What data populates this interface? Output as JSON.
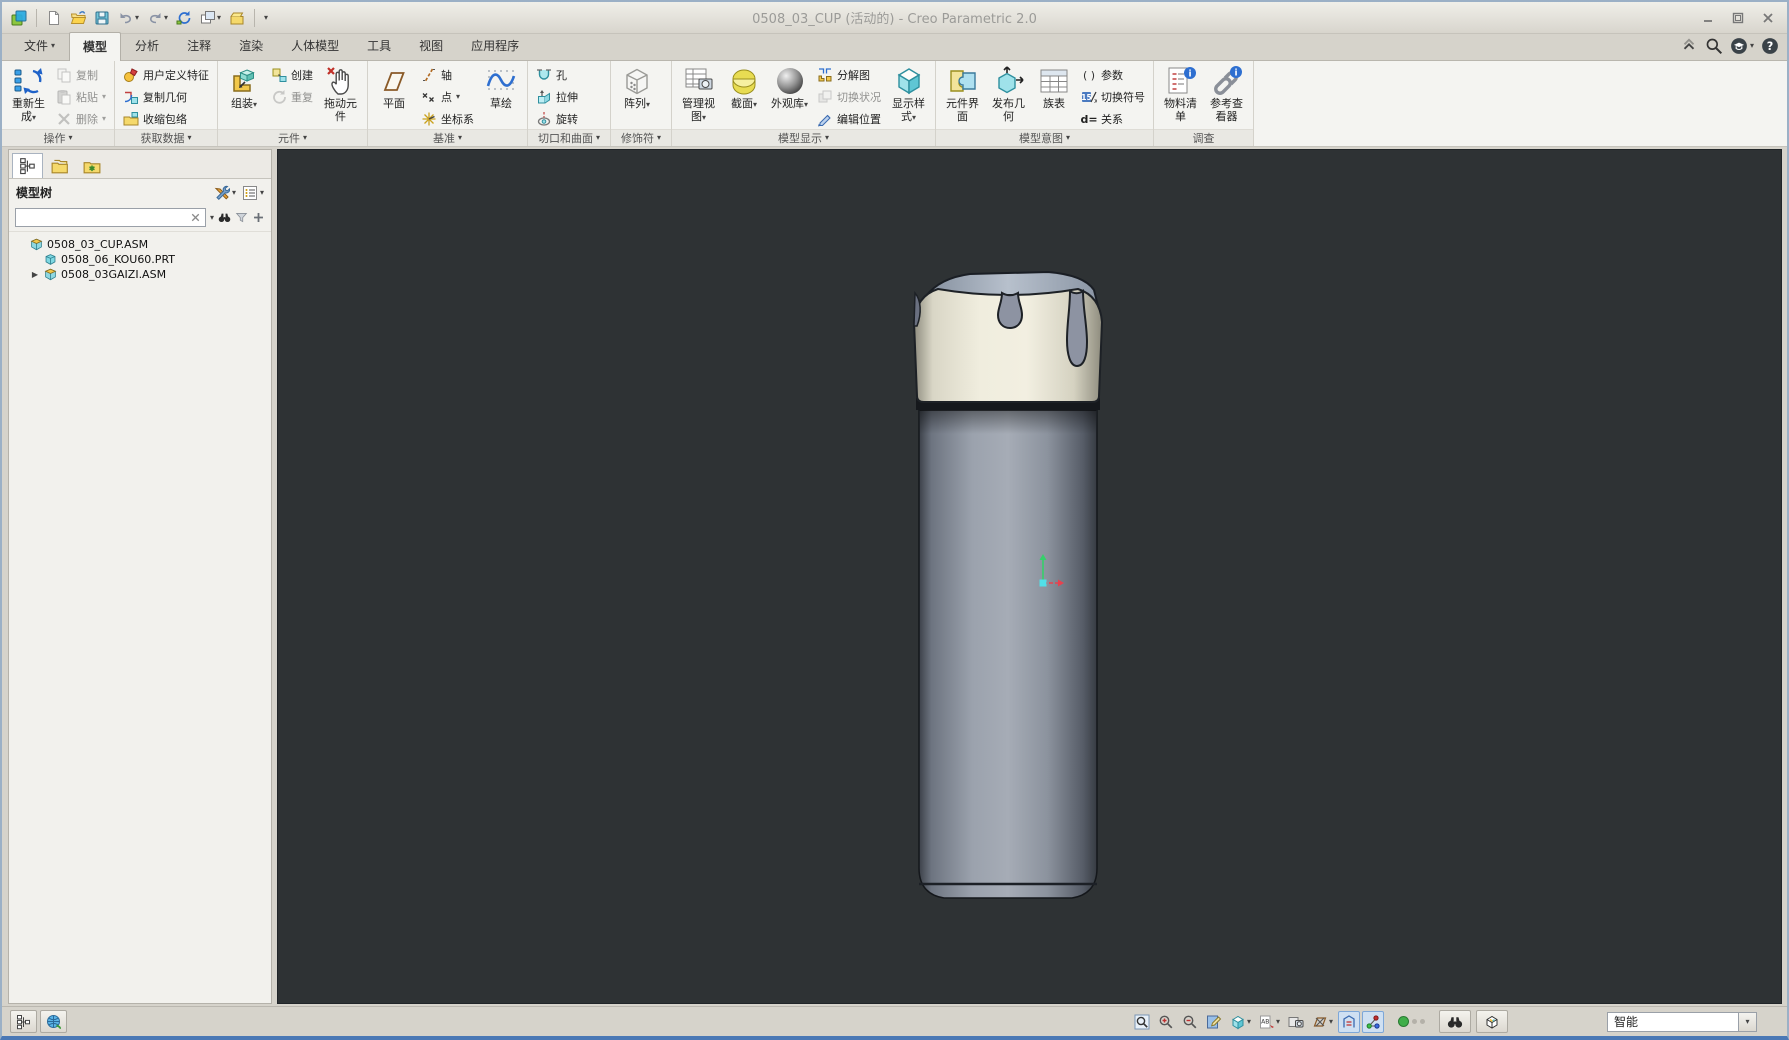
{
  "window": {
    "title": "0508_03_CUP (活动的) - Creo Parametric 2.0"
  },
  "window_controls": [
    {
      "name": "minimize-button",
      "icon": "minimize"
    },
    {
      "name": "maximize-button",
      "icon": "maximize"
    },
    {
      "name": "close-button",
      "icon": "close"
    }
  ],
  "quick_access_toolbar": [
    {
      "name": "app-menu-button",
      "icon": "app"
    },
    {
      "name": "new-file-button",
      "icon": "new"
    },
    {
      "name": "open-file-button",
      "icon": "open"
    },
    {
      "name": "save-button",
      "icon": "save"
    },
    {
      "name": "undo-button",
      "icon": "undo",
      "dropdown": true
    },
    {
      "name": "redo-button",
      "icon": "redo",
      "dropdown": true
    },
    {
      "name": "regenerate-quick-button",
      "icon": "regen-small"
    },
    {
      "name": "window-switcher-button",
      "icon": "windows",
      "dropdown": true
    },
    {
      "name": "close-window-button",
      "icon": "folder-box"
    },
    {
      "name": "customize-toolbar-button",
      "icon": "dd-only"
    }
  ],
  "menu_tabs": [
    {
      "label": "文件",
      "dropdown": true
    },
    {
      "label": "模型",
      "active": true
    },
    {
      "label": "分析"
    },
    {
      "label": "注释"
    },
    {
      "label": "渲染"
    },
    {
      "label": "人体模型"
    },
    {
      "label": "工具"
    },
    {
      "label": "视图"
    },
    {
      "label": "应用程序"
    }
  ],
  "ribbon_corner_tools": [
    {
      "name": "collapse-ribbon-button",
      "icon": "chevron-up"
    },
    {
      "name": "command-search-button",
      "icon": "magnifier"
    },
    {
      "name": "learning-connector-button",
      "icon": "learning",
      "dropdown": true
    },
    {
      "name": "help-button",
      "icon": "help"
    }
  ],
  "ribbon_groups": [
    {
      "label": "操作",
      "dropdown": true,
      "layout": [
        {
          "type": "big",
          "label": "重新生成",
          "icon": "regenerate",
          "dropdown": true,
          "name": "regenerate-button"
        },
        {
          "type": "col",
          "items": [
            {
              "label": "复制",
              "icon": "copy",
              "disabled": true,
              "name": "copy-button"
            },
            {
              "label": "粘贴",
              "icon": "paste",
              "disabled": true,
              "dropdown": true,
              "name": "paste-button"
            },
            {
              "label": "删除",
              "icon": "delete",
              "disabled": true,
              "dropdown": true,
              "name": "delete-button"
            }
          ]
        }
      ]
    },
    {
      "label": "获取数据",
      "dropdown": true,
      "layout": [
        {
          "type": "col",
          "items": [
            {
              "label": "用户定义特征",
              "icon": "udf",
              "name": "udf-button"
            },
            {
              "label": "复制几何",
              "icon": "copy-geom",
              "name": "copy-geometry-button"
            },
            {
              "label": "收缩包络",
              "icon": "shrinkwrap",
              "name": "shrinkwrap-button"
            }
          ]
        }
      ]
    },
    {
      "label": "元件",
      "dropdown": true,
      "layout": [
        {
          "type": "big",
          "label": "组装",
          "icon": "assemble",
          "dropdown": true,
          "name": "assemble-button"
        },
        {
          "type": "col",
          "items": [
            {
              "label": "创建",
              "icon": "create",
              "name": "create-component-button"
            },
            {
              "label": "重复",
              "icon": "repeat",
              "disabled": true,
              "name": "repeat-button"
            }
          ]
        },
        {
          "type": "big",
          "label": "拖动元件",
          "icon": "drag",
          "name": "drag-components-button"
        }
      ]
    },
    {
      "label": "基准",
      "dropdown": true,
      "layout": [
        {
          "type": "big",
          "label": "平面",
          "icon": "plane",
          "name": "plane-button"
        },
        {
          "type": "col",
          "items": [
            {
              "label": "轴",
              "icon": "axis",
              "name": "axis-button"
            },
            {
              "label": "点",
              "icon": "point",
              "dropdown": true,
              "name": "point-button"
            },
            {
              "label": "坐标系",
              "icon": "csys",
              "name": "coordinate-system-button"
            }
          ]
        },
        {
          "type": "big",
          "label": "草绘",
          "icon": "sketch",
          "name": "sketch-button"
        }
      ]
    },
    {
      "label": "切口和曲面",
      "dropdown": true,
      "layout": [
        {
          "type": "col",
          "items": [
            {
              "label": "孔",
              "icon": "hole",
              "name": "hole-button"
            },
            {
              "label": "拉伸",
              "icon": "extrude",
              "name": "extrude-button"
            },
            {
              "label": "旋转",
              "icon": "revolve",
              "name": "revolve-button"
            }
          ]
        }
      ]
    },
    {
      "label": "修饰符",
      "dropdown": true,
      "layout": [
        {
          "type": "big",
          "label": "阵列",
          "icon": "pattern",
          "dropdown": true,
          "name": "pattern-button"
        }
      ]
    },
    {
      "label": "模型显示",
      "dropdown": true,
      "layout": [
        {
          "type": "big",
          "label": "管理视图",
          "icon": "manage-views",
          "dropdown": true,
          "name": "manage-views-button"
        },
        {
          "type": "big",
          "label": "截面",
          "icon": "section",
          "dropdown": true,
          "name": "section-button"
        },
        {
          "type": "big",
          "label": "外观库",
          "icon": "appearance",
          "dropdown": true,
          "name": "appearance-gallery-button"
        },
        {
          "type": "col",
          "items": [
            {
              "label": "分解图",
              "icon": "exploded",
              "name": "exploded-view-button"
            },
            {
              "label": "切换状况",
              "icon": "toggle-status",
              "disabled": true,
              "name": "toggle-status-button"
            },
            {
              "label": "编辑位置",
              "icon": "edit-position",
              "name": "edit-position-button"
            }
          ]
        },
        {
          "type": "big",
          "label": "显示样式",
          "icon": "display-style",
          "dropdown": true,
          "name": "display-style-button"
        }
      ]
    },
    {
      "label": "模型意图",
      "dropdown": true,
      "layout": [
        {
          "type": "big",
          "label": "元件界面",
          "icon": "comp-interface",
          "name": "component-interface-button"
        },
        {
          "type": "big",
          "label": "发布几何",
          "icon": "publish-geom",
          "name": "publish-geometry-button"
        },
        {
          "type": "big",
          "label": "族表",
          "icon": "family-table",
          "name": "family-table-button"
        },
        {
          "type": "col",
          "items": [
            {
              "label": "参数",
              "icon": "parameters",
              "name": "parameters-button"
            },
            {
              "label": "切换符号",
              "icon": "toggle-symbols",
              "name": "toggle-symbols-button"
            },
            {
              "label": "关系",
              "icon": "relations",
              "name": "relations-button"
            }
          ]
        }
      ]
    },
    {
      "label": "调查",
      "dropdown": false,
      "layout": [
        {
          "type": "big",
          "label": "物料清单",
          "icon": "bom",
          "name": "bom-button"
        },
        {
          "type": "big",
          "label": "参考查看器",
          "icon": "ref-viewer",
          "name": "reference-viewer-button"
        }
      ]
    }
  ],
  "model_tree_panel": {
    "tabs": [
      {
        "name": "model-tree-tab",
        "icon": "tree",
        "active": true
      },
      {
        "name": "folder-browser-tab",
        "icon": "folders",
        "active": false
      },
      {
        "name": "favorites-tab",
        "icon": "favorites",
        "active": false
      }
    ],
    "title": "模型树",
    "header_tools": [
      {
        "name": "tree-settings-button",
        "icon": "hammer-wrench",
        "dropdown": true
      },
      {
        "name": "tree-columns-button",
        "icon": "list-settings",
        "dropdown": true
      }
    ],
    "search": {
      "value": "",
      "tools": [
        {
          "name": "clear-search-button",
          "icon": "clear-x",
          "inside": true
        },
        {
          "name": "search-options-button",
          "icon": "dd-only"
        },
        {
          "name": "find-in-tree-button",
          "icon": "binoculars"
        },
        {
          "name": "tree-filter-button",
          "icon": "funnel"
        },
        {
          "name": "add-column-button",
          "icon": "plus"
        }
      ]
    },
    "tree": [
      {
        "label": "0508_03_CUP.ASM",
        "icon": "assembly-node",
        "level": 0,
        "expandable": false
      },
      {
        "label": "0508_06_KOU60.PRT",
        "icon": "part-node",
        "level": 1,
        "expandable": false
      },
      {
        "label": "0508_03GAIZI.ASM",
        "icon": "assembly-node",
        "level": 1,
        "expandable": true
      }
    ]
  },
  "status_bar": {
    "left_buttons": [
      {
        "name": "toggle-model-tree-button",
        "icon": "tree"
      },
      {
        "name": "toggle-browser-button",
        "icon": "browser"
      }
    ],
    "view_tools": [
      {
        "name": "zoom-refit-button",
        "icon": "zoom-refit"
      },
      {
        "name": "zoom-in-button",
        "icon": "zoom-in"
      },
      {
        "name": "zoom-out-button",
        "icon": "zoom-out"
      },
      {
        "name": "repaint-button",
        "icon": "repaint"
      },
      {
        "name": "display-style-status-button",
        "icon": "display-style-small",
        "dropdown": true
      },
      {
        "name": "annotation-display-button",
        "icon": "annotations",
        "dropdown": true
      },
      {
        "name": "saved-orientations-button",
        "icon": "saved-views"
      },
      {
        "name": "datum-display-button",
        "icon": "datum-display",
        "dropdown": true
      },
      {
        "name": "annotations-toggle-button",
        "icon": "annotation-toggle",
        "pressed": true
      },
      {
        "name": "spin-center-toggle-button",
        "icon": "spin-center",
        "pressed": true
      }
    ],
    "regen_status": {
      "name": "regeneration-status-indicator",
      "color": "#3fae49"
    },
    "tools": [
      {
        "name": "search-model-button",
        "icon": "binoculars"
      },
      {
        "name": "accessory-window-button",
        "icon": "accessory-box"
      }
    ],
    "selection_filter": {
      "label": "智能"
    }
  },
  "viewport": {
    "background_color": "#2e3234",
    "model_colors": {
      "cap": "#eeebdc",
      "cap_top": "#a9b3c0",
      "drips": "#8d93a2",
      "body_light": "#a6acb6",
      "body_dark": "#3c4149"
    },
    "spin_center_colors": {
      "x_axis": "#e8414e",
      "y_axis": "#35d06a",
      "origin": "#52e0e8"
    }
  }
}
